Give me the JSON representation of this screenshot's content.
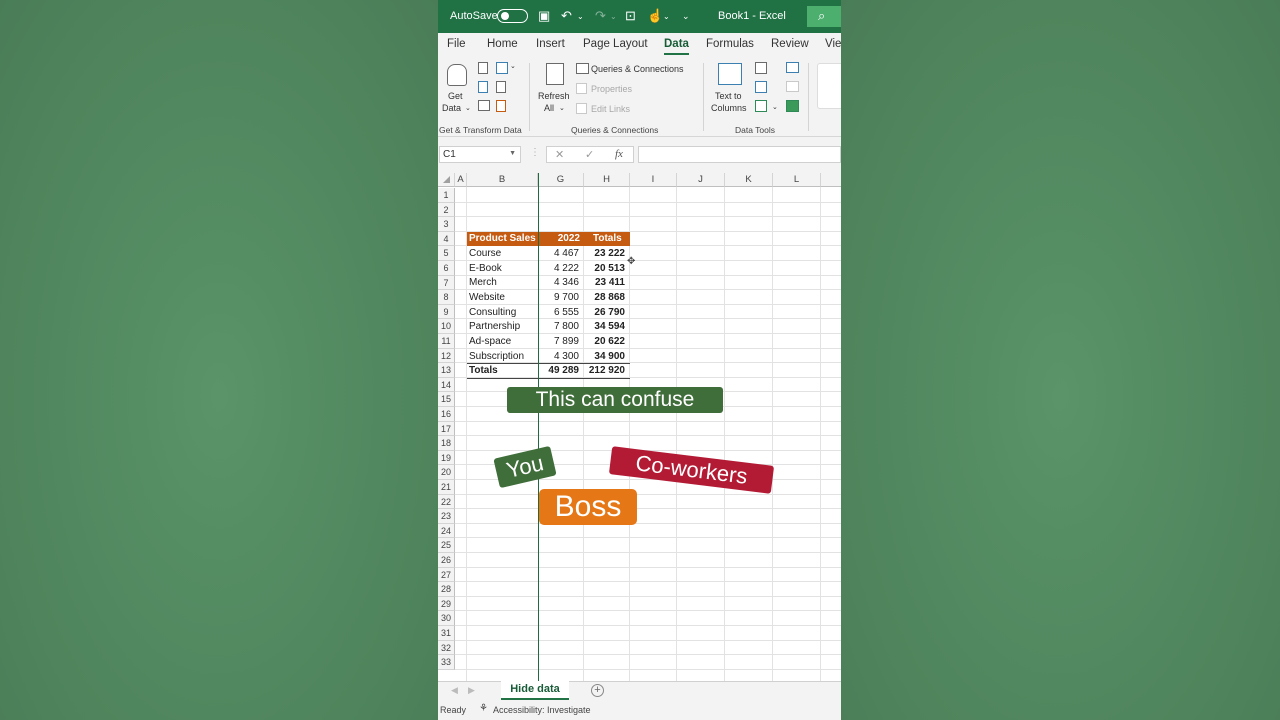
{
  "titlebar": {
    "autosave_label": "AutoSave",
    "title": "Book1 - Excel",
    "icons": [
      "save-icon",
      "undo-icon",
      "redo-icon",
      "chart-icon",
      "touch-icon",
      "customize-icon",
      "search-icon"
    ]
  },
  "tabs": [
    {
      "label": "File"
    },
    {
      "label": "Home"
    },
    {
      "label": "Insert"
    },
    {
      "label": "Page Layout"
    },
    {
      "label": "Data",
      "active": true
    },
    {
      "label": "Formulas"
    },
    {
      "label": "Review"
    },
    {
      "label": "Vie"
    }
  ],
  "ribbon": {
    "get_data": {
      "line1": "Get",
      "line2": "Data"
    },
    "get_transform_group": "Get & Transform Data",
    "refresh": {
      "line1": "Refresh",
      "line2": "All"
    },
    "queries_connections": "Queries & Connections",
    "properties": "Properties",
    "edit_links": "Edit Links",
    "queries_group": "Queries & Connections",
    "text_to_columns": {
      "line1": "Text to",
      "line2": "Columns"
    },
    "data_tools_group": "Data Tools"
  },
  "formula_bar": {
    "name_box": "C1",
    "cancel_glyph": "✕",
    "enter_glyph": "✓",
    "fx_glyph": "fx",
    "formula": ""
  },
  "grid": {
    "columns": [
      "A",
      "B",
      "G",
      "H",
      "I",
      "J",
      "K",
      "L"
    ],
    "row_numbers": [
      "1",
      "2",
      "3",
      "4",
      "5",
      "6",
      "7",
      "8",
      "9",
      "10",
      "11",
      "12",
      "13",
      "14",
      "15",
      "16",
      "17",
      "18",
      "19",
      "20",
      "21",
      "22",
      "23",
      "24",
      "25",
      "26",
      "27",
      "28",
      "29",
      "30",
      "31",
      "32",
      "33"
    ],
    "header": {
      "product": "Product Sales",
      "year": "2022",
      "totals": "Totals"
    },
    "rows": [
      {
        "name": "Course",
        "g": "4 467",
        "h": "23 222"
      },
      {
        "name": "E-Book",
        "g": "4 222",
        "h": "20 513"
      },
      {
        "name": "Merch",
        "g": "4 346",
        "h": "23 411"
      },
      {
        "name": "Website",
        "g": "9 700",
        "h": "28 868"
      },
      {
        "name": "Consulting",
        "g": "6 555",
        "h": "26 790"
      },
      {
        "name": "Partnership",
        "g": "7 800",
        "h": "34 594"
      },
      {
        "name": "Ad-space",
        "g": "7 899",
        "h": "20 622"
      },
      {
        "name": "Subscription",
        "g": "4 300",
        "h": "34 900"
      }
    ],
    "totals_row": {
      "name": "Totals",
      "g": "49 289",
      "h": "212 920"
    }
  },
  "overlay": {
    "headline": "This can confuse",
    "you": "You",
    "coworkers": "Co-workers",
    "boss": "Boss"
  },
  "colors": {
    "excel_green": "#207245",
    "header_orange": "#c55a11",
    "tag_green": "#3f6e3a",
    "tag_red": "#b31b35",
    "tag_orange": "#e67716"
  },
  "sheets": {
    "active": "Hide data",
    "add_glyph": "+"
  },
  "status": {
    "ready": "Ready",
    "accessibility": "Accessibility: Investigate"
  }
}
